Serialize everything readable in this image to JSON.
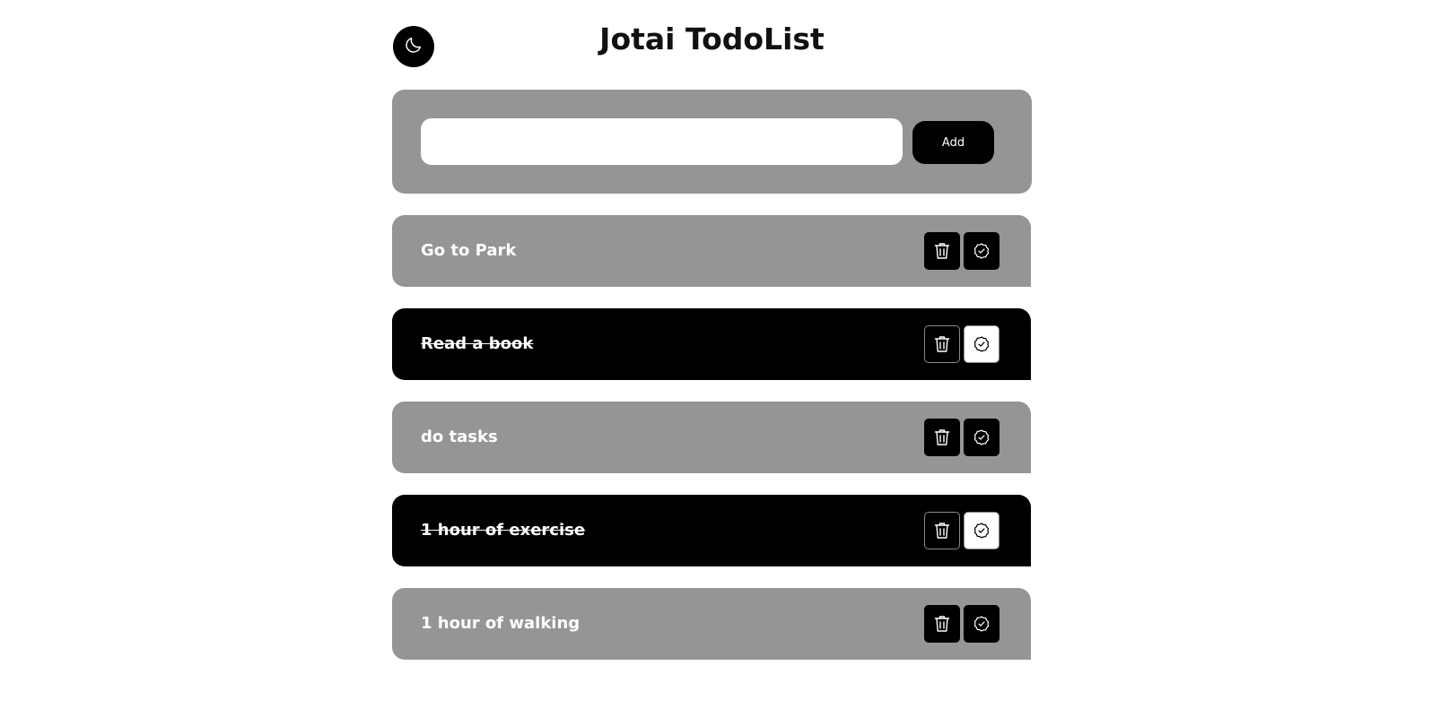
{
  "header": {
    "title": "Jotai TodoList",
    "theme_toggle_icon": "moon-icon"
  },
  "add_form": {
    "input_value": "",
    "input_placeholder": "",
    "add_label": "Add"
  },
  "todos": [
    {
      "text": "Go to Park",
      "completed": false
    },
    {
      "text": "Read a book",
      "completed": true
    },
    {
      "text": "do tasks",
      "completed": false
    },
    {
      "text": "1 hour of exercise",
      "completed": true
    },
    {
      "text": "1 hour of walking",
      "completed": false
    }
  ],
  "icons": {
    "delete": "trash-icon",
    "complete": "check-badge-icon"
  },
  "colors": {
    "panel": "#969596",
    "completed": "#000000",
    "text": "#ffffff"
  }
}
